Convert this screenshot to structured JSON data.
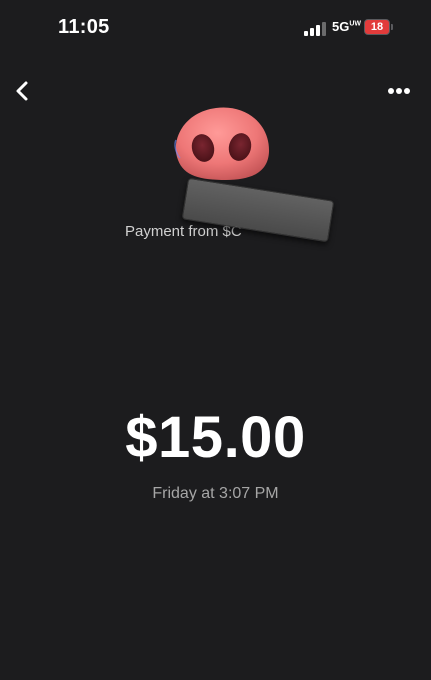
{
  "status_bar": {
    "time": "11:05",
    "network": "5G",
    "network_suffix": "UW",
    "battery_level": "18"
  },
  "header": {
    "back_icon": "chevron-left-icon",
    "more_icon": "more-horizontal-icon"
  },
  "payment": {
    "from_label": "Payment from $C",
    "amount": "$15.00",
    "date": "Friday at 3:07 PM"
  },
  "colors": {
    "background": "#1c1c1e",
    "avatar_pink": "#ee7777",
    "battery_red": "#e23b3b"
  }
}
